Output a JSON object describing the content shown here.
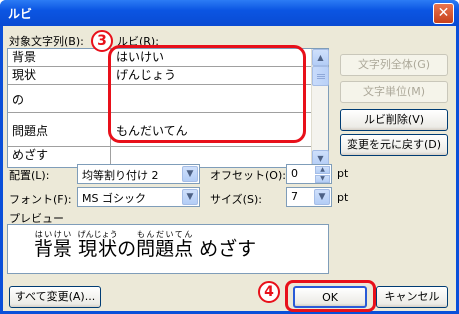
{
  "window": {
    "title": "ルビ",
    "close_glyph": "✕"
  },
  "labels": {
    "target_string": "対象文字列(B):",
    "ruby": "ルビ(R):",
    "placement": "配置(L):",
    "offset": "オフセット(O):",
    "font": "フォント(F):",
    "size": "サイズ(S):",
    "preview": "プレビュー",
    "pt1": "pt",
    "pt2": "pt"
  },
  "grid": {
    "rows": [
      {
        "base": "背景",
        "ruby": "はいけい"
      },
      {
        "base": "現状",
        "ruby": "げんじょう"
      },
      {
        "base": "の",
        "ruby": ""
      },
      {
        "base": "問題点",
        "ruby": "もんだいてん"
      },
      {
        "base": "めざす",
        "ruby": ""
      }
    ]
  },
  "buttons": {
    "whole_string": "文字列全体(G)",
    "char_unit": "文字単位(M)",
    "delete_ruby": "ルビ削除(V)",
    "restore": "変更を元に戻す(D)",
    "change_all": "すべて変更(A)...",
    "ok": "OK",
    "cancel": "キャンセル"
  },
  "fields": {
    "placement_value": "均等割り付け 2",
    "offset_value": "0",
    "font_value": "MS ゴシック",
    "size_value": "7"
  },
  "preview": {
    "segments": [
      {
        "base": "背景",
        "ruby": "はいけい"
      },
      {
        "base": "現状",
        "ruby": "げんじょう"
      },
      {
        "base": "の",
        "ruby": ""
      },
      {
        "base": "問題点",
        "ruby": "もんだいてん"
      },
      {
        "base": "めざす",
        "ruby": ""
      }
    ]
  },
  "annotations": {
    "step3": "3",
    "step4": "4"
  },
  "colors": {
    "title_bar": "#0b55e2",
    "dialog_bg": "#ece9d8",
    "annotation_red": "#e8101a"
  },
  "icons": {
    "dropdown": "▼",
    "scroll_up": "▲",
    "scroll_down": "▼",
    "spin_up": "▲",
    "spin_down": "▼"
  }
}
